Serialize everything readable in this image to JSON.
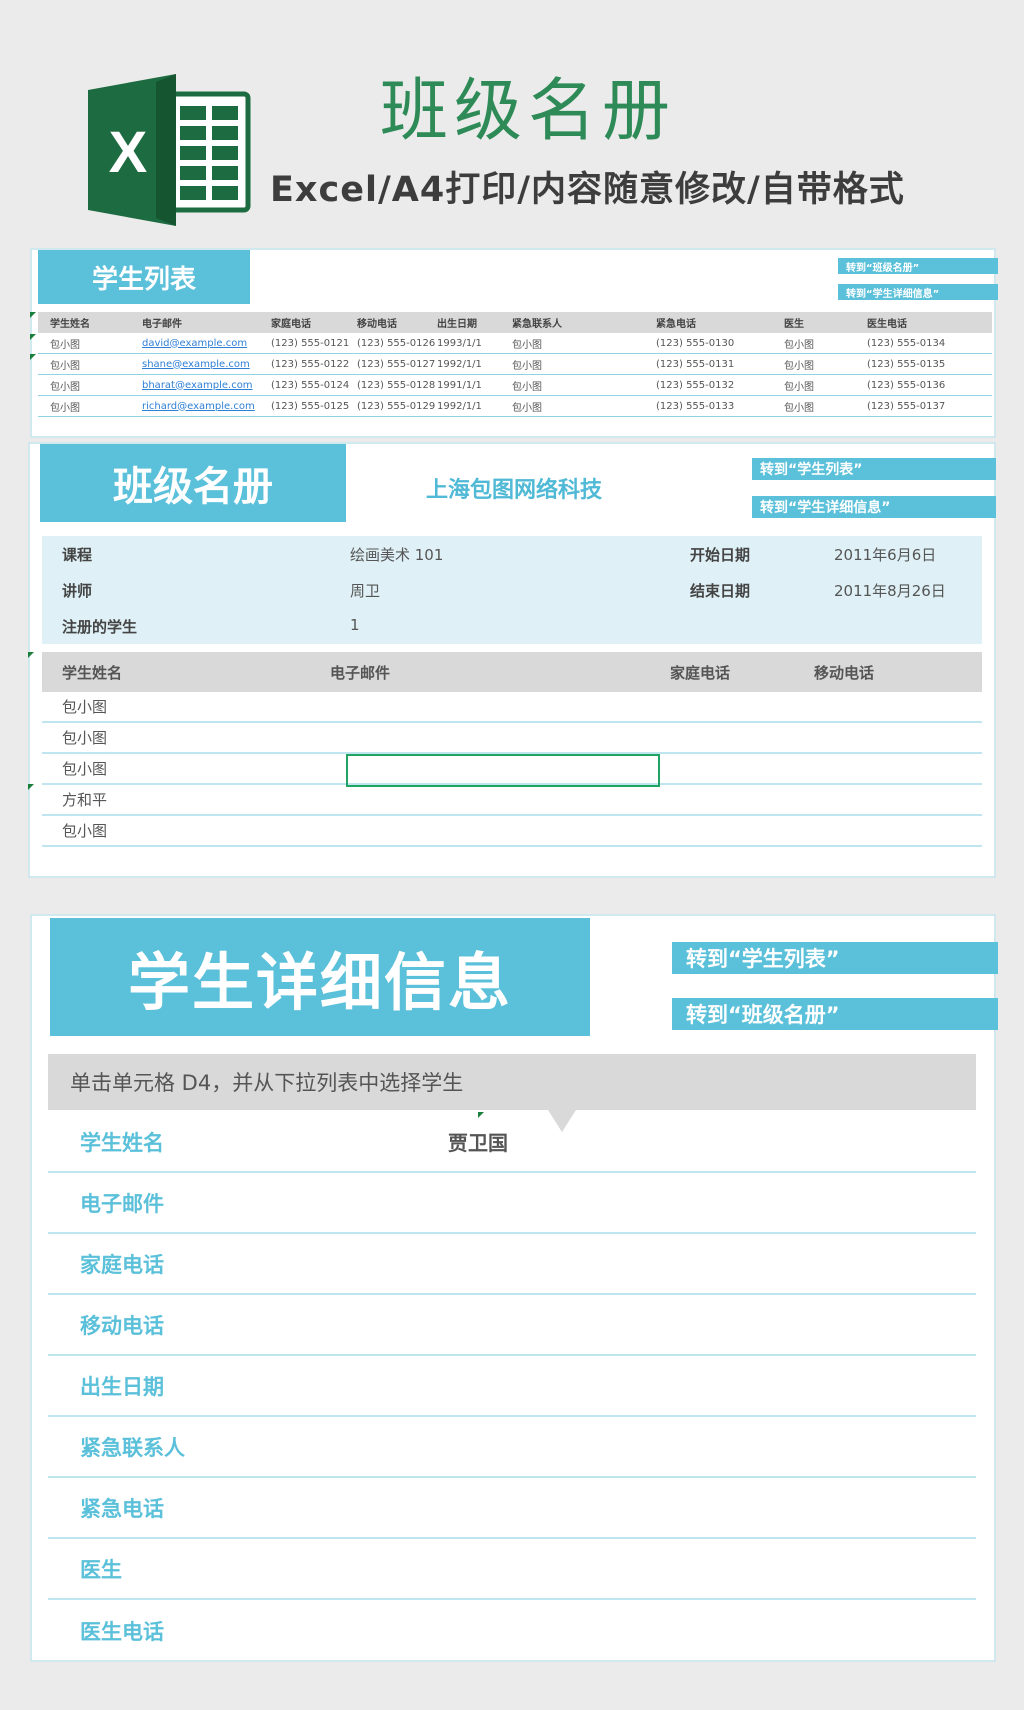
{
  "header": {
    "title": "班级名册",
    "subtitle": "Excel/A4打印/内容随意修改/自带格式",
    "logo_letter": "X",
    "logo_icon": "excel-logo-icon"
  },
  "colors": {
    "accent": "#5bc0d9",
    "title_green": "#2e8b57",
    "info_bg": "#dff1f6",
    "header_gray": "#d9d9d9",
    "selection_green": "#1fa463",
    "link_blue": "#2e7fd6"
  },
  "student_list": {
    "title": "学生列表",
    "nav": [
      "转到“班级名册”",
      "转到“学生详细信息”"
    ],
    "columns": [
      "学生姓名",
      "电子邮件",
      "家庭电话",
      "移动电话",
      "出生日期",
      "紧急联系人",
      "紧急电话",
      "医生",
      "医生电话"
    ],
    "rows": [
      [
        "包小图",
        "david@example.com",
        "(123) 555-0121",
        "(123) 555-0126",
        "1993/1/1",
        "包小图",
        "(123) 555-0130",
        "包小图",
        "(123) 555-0134"
      ],
      [
        "包小图",
        "shane@example.com",
        "(123) 555-0122",
        "(123) 555-0127",
        "1992/1/1",
        "包小图",
        "(123) 555-0131",
        "包小图",
        "(123) 555-0135"
      ],
      [
        "包小图",
        "bharat@example.com",
        "(123) 555-0124",
        "(123) 555-0128",
        "1991/1/1",
        "包小图",
        "(123) 555-0132",
        "包小图",
        "(123) 555-0136"
      ],
      [
        "包小图",
        "richard@example.com",
        "(123) 555-0125",
        "(123) 555-0129",
        "1992/1/1",
        "包小图",
        "(123) 555-0133",
        "包小图",
        "(123) 555-0137"
      ]
    ]
  },
  "roster": {
    "title": "班级名册",
    "company": "上海包图网络科技",
    "nav": [
      "转到“学生列表”",
      "转到“学生详细信息”"
    ],
    "info": {
      "course_label": "课程",
      "course_value": "绘画美术 101",
      "instructor_label": "讲师",
      "instructor_value": "周卫",
      "enrolled_label": "注册的学生",
      "enrolled_value": "1",
      "start_label": "开始日期",
      "start_value": "2011年6月6日",
      "end_label": "结束日期",
      "end_value": "2011年8月26日"
    },
    "columns": [
      "学生姓名",
      "电子邮件",
      "家庭电话",
      "移动电话"
    ],
    "rows": [
      [
        "包小图",
        "",
        "",
        ""
      ],
      [
        "包小图",
        "",
        "",
        ""
      ],
      [
        "包小图",
        "",
        "",
        ""
      ],
      [
        "方和平",
        "",
        "",
        ""
      ],
      [
        "包小图",
        "",
        "",
        ""
      ]
    ]
  },
  "student_detail": {
    "title": "学生详细信息",
    "nav": [
      "转到“学生列表”",
      "转到“班级名册”"
    ],
    "instruction": "单击单元格 D4，并从下拉列表中选择学生",
    "fields": [
      {
        "label": "学生姓名",
        "value": "贾卫国"
      },
      {
        "label": "电子邮件",
        "value": ""
      },
      {
        "label": "家庭电话",
        "value": ""
      },
      {
        "label": "移动电话",
        "value": ""
      },
      {
        "label": "出生日期",
        "value": ""
      },
      {
        "label": "紧急联系人",
        "value": ""
      },
      {
        "label": "紧急电话",
        "value": ""
      },
      {
        "label": "医生",
        "value": ""
      },
      {
        "label": "医生电话",
        "value": ""
      }
    ]
  }
}
